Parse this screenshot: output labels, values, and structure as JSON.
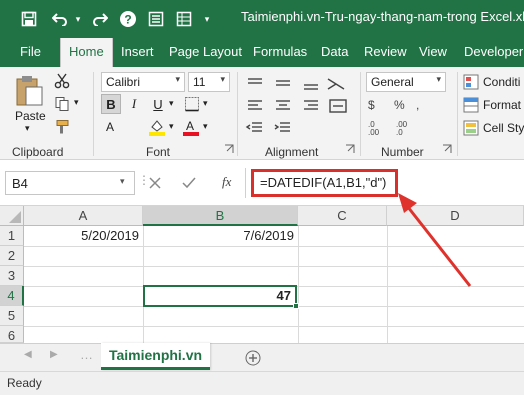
{
  "window": {
    "title": "Taimienphi.vn-Tru-ngay-thang-nam-trong Excel.xlsx",
    "accent_color": "#217346"
  },
  "quick_access": {
    "icons": [
      "save-icon",
      "undo-icon",
      "redo-icon",
      "help-icon",
      "form-icon",
      "customize-icon"
    ]
  },
  "tabs": [
    "File",
    "Home",
    "Insert",
    "Page Layout",
    "Formulas",
    "Data",
    "Review",
    "View",
    "Developer"
  ],
  "ribbon": {
    "clipboard": {
      "label": "Clipboard",
      "paste_label": "Paste"
    },
    "font": {
      "label": "Font",
      "font_name": "Calibri",
      "font_size": "11",
      "bold": "B",
      "italic": "I",
      "underline": "U"
    },
    "alignment": {
      "label": "Alignment"
    },
    "number": {
      "label": "Number",
      "format": "General"
    },
    "styles": {
      "items": [
        "Conditi",
        "Format",
        "Cell Sty"
      ]
    }
  },
  "formula_bar": {
    "name_box": "B4",
    "fx": "fx",
    "formula": "=DATEDIF(A1,B1,\"d\")",
    "highlight_color": "#d9302c"
  },
  "grid": {
    "columns": [
      "A",
      "B",
      "C",
      "D"
    ],
    "rows": [
      "1",
      "2",
      "3",
      "4",
      "5",
      "6"
    ],
    "cells": {
      "A1": "5/20/2019",
      "B1": "7/6/2019",
      "B4": "47"
    },
    "active_cell": "B4"
  },
  "sheets": {
    "active": "Taimienphi.vn"
  },
  "status": {
    "text": "Ready"
  }
}
